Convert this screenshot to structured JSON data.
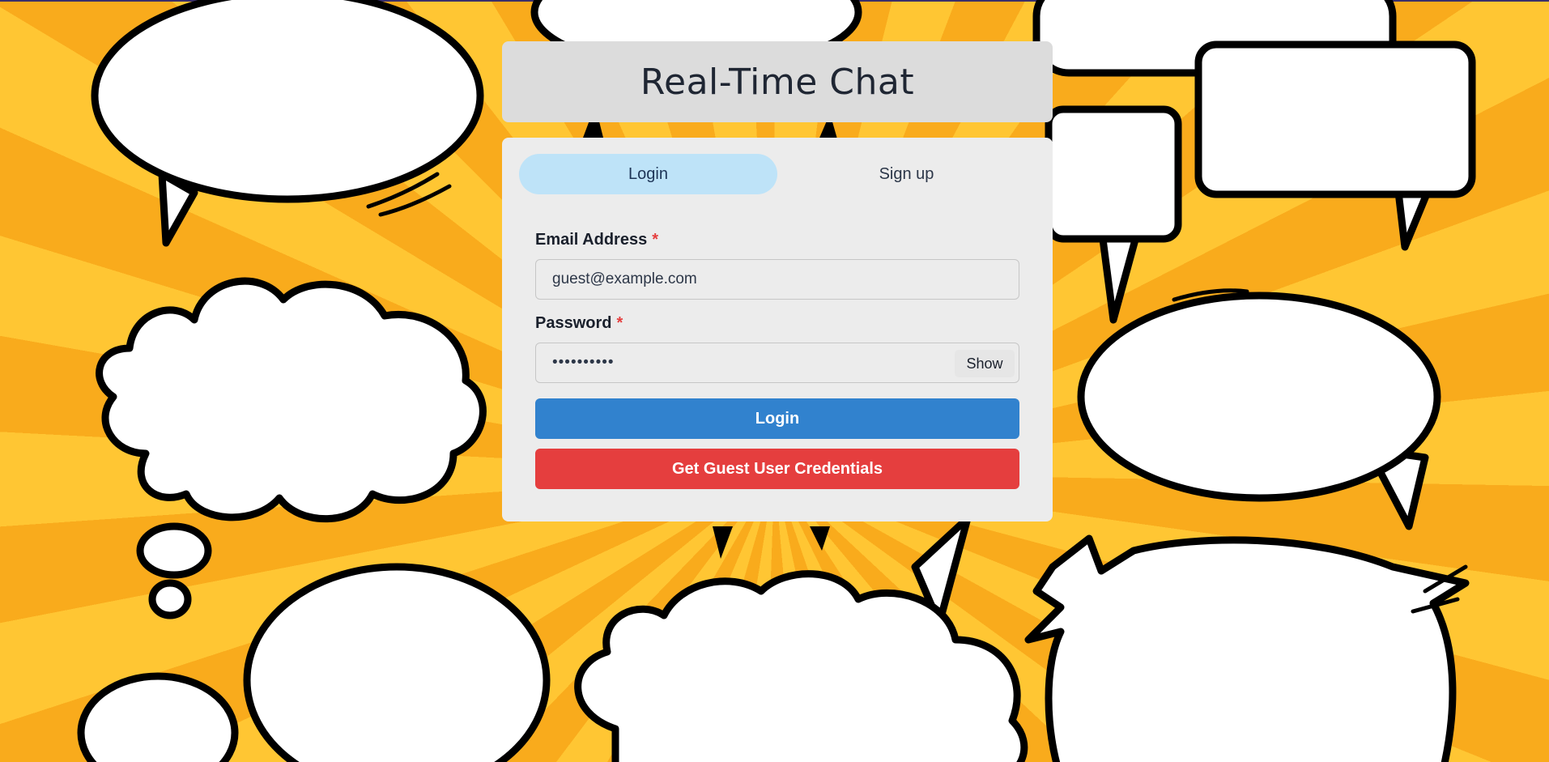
{
  "app": {
    "title": "Real-Time Chat"
  },
  "tabs": [
    {
      "label": "Login",
      "active": true
    },
    {
      "label": "Sign up",
      "active": false
    }
  ],
  "form": {
    "email": {
      "label": "Email Address",
      "required_marker": "*",
      "value": "guest@example.com"
    },
    "password": {
      "label": "Password",
      "required_marker": "*",
      "value": "••••••••••",
      "toggle_label": "Show"
    },
    "login_button": "Login",
    "guest_button": "Get Guest User Credentials"
  },
  "colors": {
    "accent_blue": "#3182ce",
    "danger_red": "#e53e3e",
    "active_tab": "#bee3f8",
    "background_orange": "#f9ab1c"
  },
  "background": {
    "theme": "comic speech bubbles"
  }
}
